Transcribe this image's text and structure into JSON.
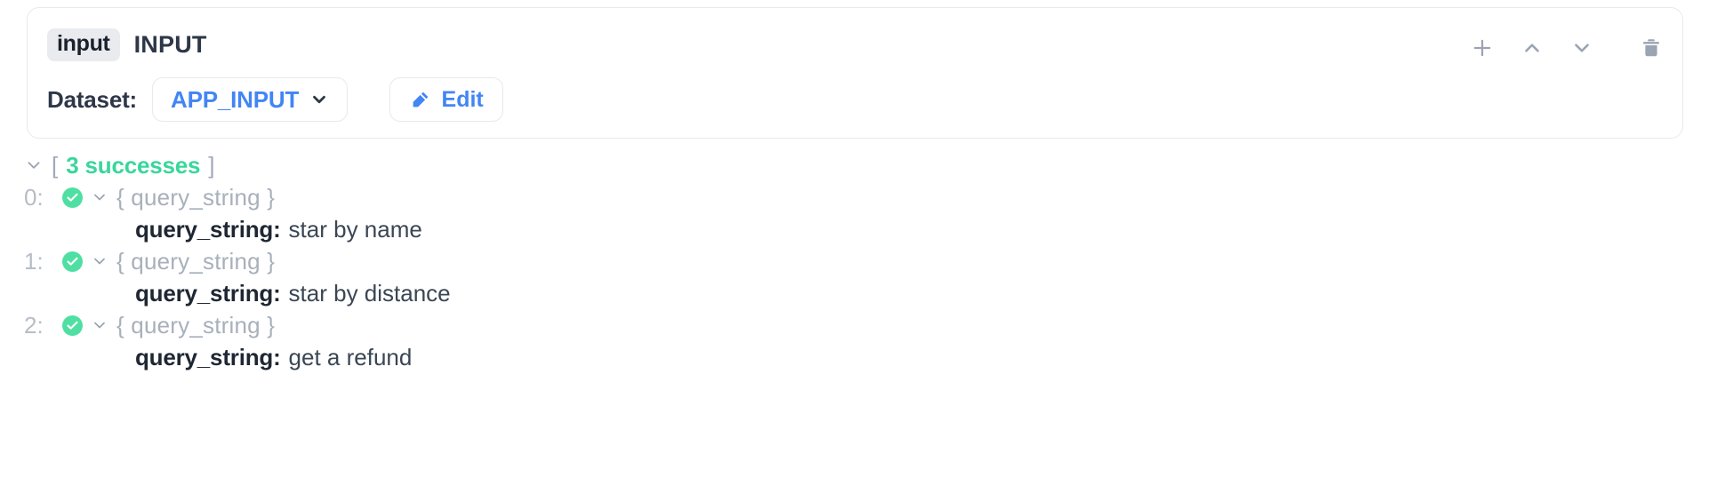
{
  "card": {
    "badge_label": "input",
    "title": "INPUT",
    "dataset_label": "Dataset:",
    "dataset_value": "APP_INPUT",
    "edit_label": "Edit",
    "toolbar": {
      "add": "plus-icon",
      "move_up": "chevron-up-icon",
      "move_down": "chevron-down-icon",
      "delete": "trash-icon"
    }
  },
  "results": {
    "collapse_icon": "chevron-down-icon",
    "bracket_open": "[",
    "bracket_close": "]",
    "summary": "3 successes",
    "items": [
      {
        "index": "0:",
        "status_icon": "check-circle-icon",
        "expand_icon": "chevron-down-icon",
        "object_label": "{ query_string }",
        "key": "query_string:",
        "value": "star by name"
      },
      {
        "index": "1:",
        "status_icon": "check-circle-icon",
        "expand_icon": "chevron-down-icon",
        "object_label": "{ query_string }",
        "key": "query_string:",
        "value": "star by distance"
      },
      {
        "index": "2:",
        "status_icon": "check-circle-icon",
        "expand_icon": "chevron-down-icon",
        "object_label": "{ query_string }",
        "key": "query_string:",
        "value": "get a refund"
      }
    ]
  },
  "colors": {
    "accent_blue": "#4285f4",
    "success_green": "#3ad69b",
    "check_green": "#4fdfa3",
    "text_dark": "#2d3748",
    "text_muted": "#a8b0bc",
    "border": "#e6e9ef",
    "badge_bg": "#e9ebef",
    "icon_gray": "#9aa4b2"
  }
}
